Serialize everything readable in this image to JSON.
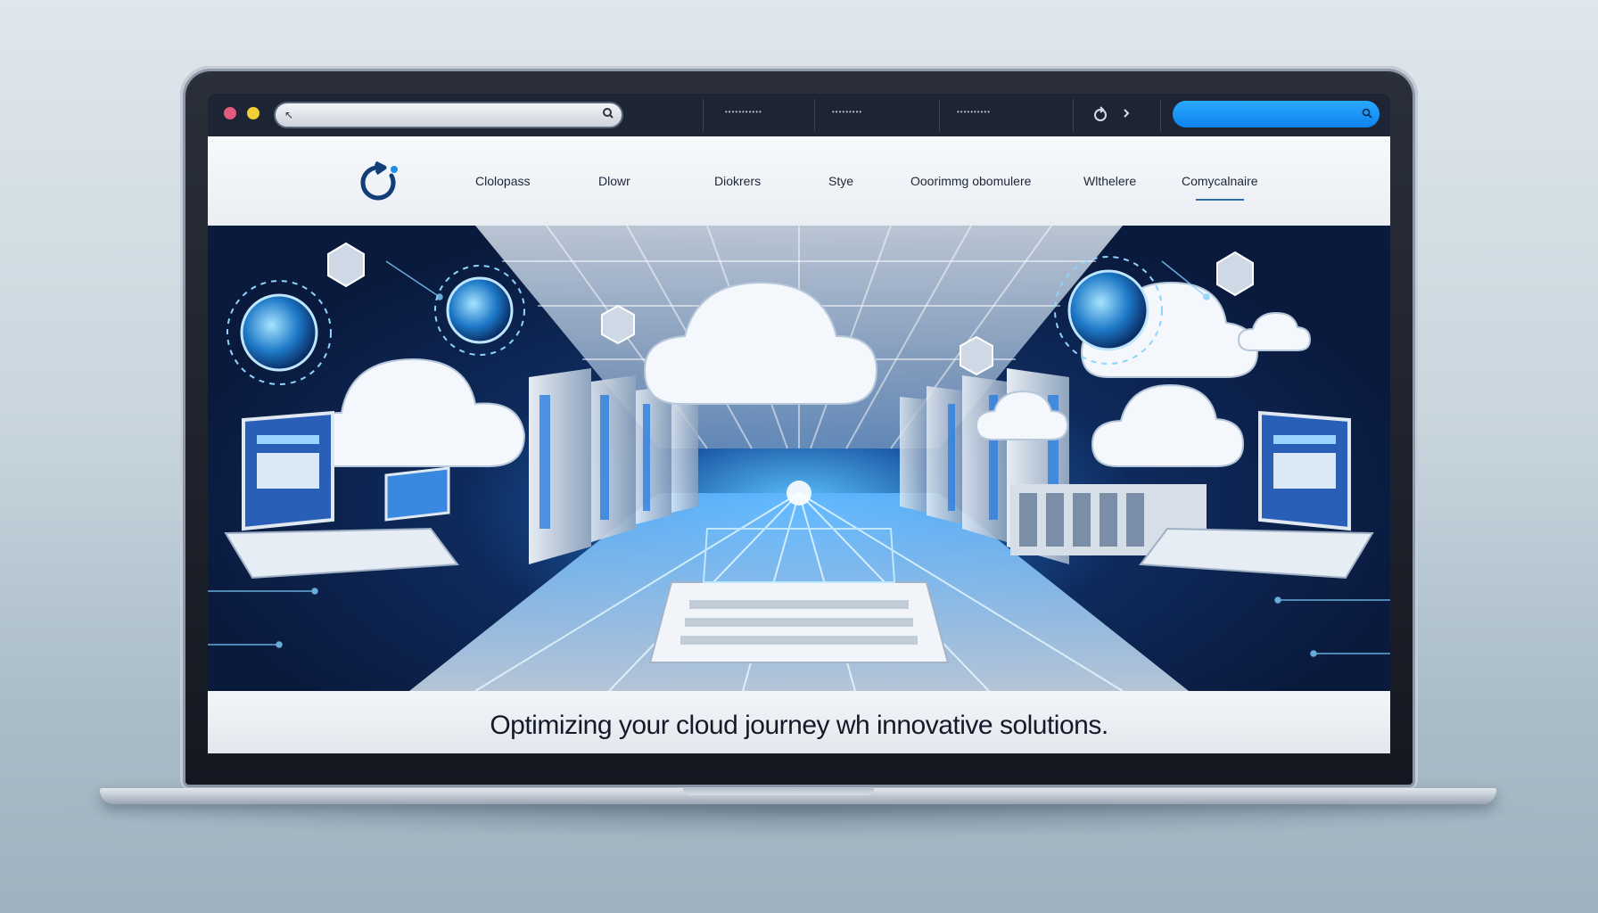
{
  "browser": {
    "address_value": "",
    "toolbar_links": [
      "•••••••••••",
      "•••••••••",
      "••••••••••"
    ],
    "icons": [
      "address-icon",
      "search-icon",
      "refresh-icon",
      "settings-icon",
      "search-icon"
    ],
    "accent_color": "#1a93f7"
  },
  "nav": {
    "items": [
      "Clolopass",
      "Dlowr",
      "Diokrers",
      "Stye",
      "Ooorimmg obomulere",
      "Wlthelere",
      "Comycalnaire"
    ],
    "active_index": 6,
    "logo_icon": "cloud-refresh-logo-icon"
  },
  "hero": {
    "image_description_icons": [
      "cloud-icon",
      "globe-icon",
      "server-rack-icon",
      "laptop-icon",
      "keyboard-icon"
    ]
  },
  "caption": {
    "text": "Optimizing your cloud journey wh innovative solutions."
  }
}
